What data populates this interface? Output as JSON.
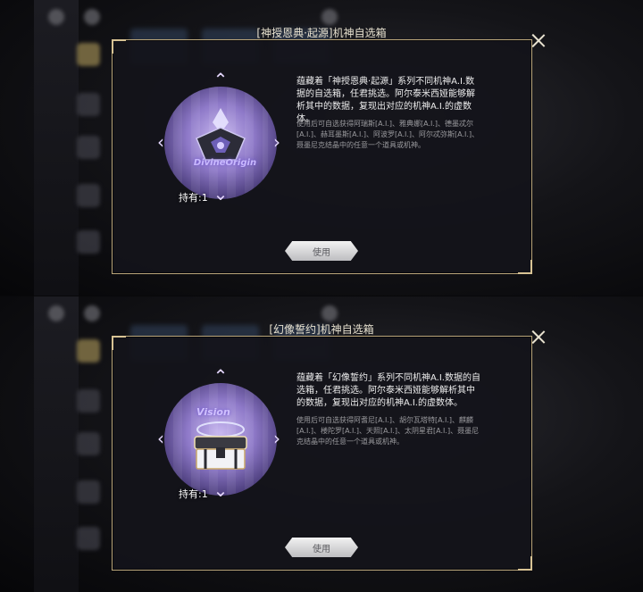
{
  "panels": [
    {
      "title": "[神授恩典·起源]机神自选箱",
      "desc_main": "蕴藏着「神授恩典·起源」系列不同机神A.I.数据的自选箱，任君挑选。阿尔泰米西娅能够解析其中的数据，复现出对应的机神A.I.的虚数体。",
      "desc_sub": "使用后可自选获得阿瑞斯[A.I.]、雅典娜[A.I.]、德墨忒尔[A.I.]、赫耳墨斯[A.I.]、阿波罗[A.I.]、阿尔忒弥斯[A.I.]、聂墨尼克结晶中的任意一个道具或机神。",
      "item_brand": "DivineOrigin",
      "held_label": "持有:1",
      "use_label": "使用"
    },
    {
      "title": "[幻像誓约]机神自选箱",
      "desc_main": "蕴藏着「幻像誓约」系列不同机神A.I.数据的自选箱，任君挑选。阿尔泰米西娅能够解析其中的数据，复现出对应的机神A.I.的虚数体。",
      "desc_sub": "使用后可自选获得阿耆尼[A.I.]、胡尔瓦塔特[A.I.]、麒麟[A.I.]、楼陀罗[A.I.]、天照[A.I.]、太阴星君[A.I.]、聂墨尼克结晶中的任意一个道具或机神。",
      "item_brand": "Vision",
      "held_label": "持有:1",
      "use_label": "使用"
    }
  ],
  "icons": {
    "close": "close-icon",
    "chevron_up": "chevron-up-icon",
    "chevron_down": "chevron-down-icon",
    "chevron_left": "chevron-left-icon",
    "chevron_right": "chevron-right-icon"
  },
  "colors": {
    "border_gold": "#b9a57a",
    "dialog_bg": "#14141a",
    "item_purple": "#8e79c8"
  }
}
